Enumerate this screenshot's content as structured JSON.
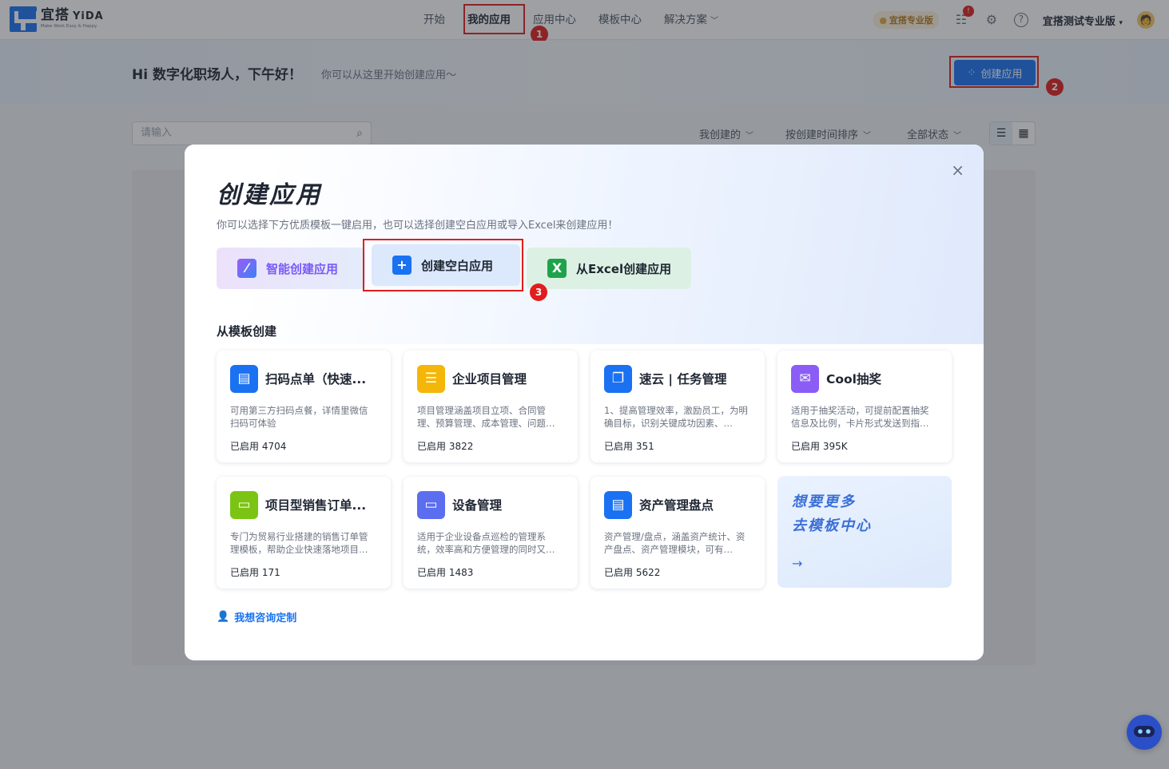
{
  "brand": {
    "name": "宜搭",
    "name_en": "YiDA",
    "slogan": "Make Work Easy & Happy",
    "color": "#1a72f2"
  },
  "nav": {
    "items": [
      {
        "label": "开始"
      },
      {
        "label": "我的应用",
        "active": true
      },
      {
        "label": "应用中心"
      },
      {
        "label": "模板中心"
      },
      {
        "label": "解决方案"
      }
    ]
  },
  "top_right": {
    "pro_tag": "宜搭专业版",
    "notice_count": "!",
    "account": "宜搭测试专业版",
    "avatar": "🧑"
  },
  "greeting": {
    "title": "Hi 数字化职场人，下午好！",
    "subtitle": "你可以从这里开始创建应用～",
    "create_button": "创建应用"
  },
  "filters": {
    "search_placeholder": "请输入",
    "created_by": "我创建的",
    "sort": "按创建时间排序",
    "status": "全部状态"
  },
  "annotations": [
    "1",
    "2",
    "3"
  ],
  "modal": {
    "title": "创建应用",
    "subtitle": "你可以选择下方优质模板一键启用，也可以选择创建空白应用或导入Excel来创建应用！",
    "options": {
      "ai": "智能创建应用",
      "blank": "创建空白应用",
      "excel": "从Excel创建应用"
    },
    "template_section": "从模板创建",
    "templates": [
      {
        "title": "扫码点单（快速...",
        "desc": "可用第三方扫码点餐，详情里微信扫码可体验",
        "count": "已启用 4704",
        "color": "#1a72f2",
        "icon": "▤"
      },
      {
        "title": "企业项目管理",
        "desc": "项目管理涵盖项目立项、合同管理、预算管理、成本管理、问题…",
        "count": "已启用 3822",
        "color": "#f5b60a",
        "icon": "☰"
      },
      {
        "title": "速云 | 任务管理",
        "desc": "1、提高管理效率，激励员工，为明确目标，识别关键成功因素、…",
        "count": "已启用 351",
        "color": "#1a72f2",
        "icon": "❐"
      },
      {
        "title": "Cool抽奖",
        "desc": "适用于抽奖活动，可提前配置抽奖信息及比例，卡片形式发送到指…",
        "count": "已启用 395K",
        "color": "#8b5cf6",
        "icon": "✉"
      },
      {
        "title": "项目型销售订单...",
        "desc": "专门为贸易行业搭建的销售订单管理模板，帮助企业快速落地项目…",
        "count": "已启用 171",
        "color": "#7cc414",
        "icon": "▭"
      },
      {
        "title": "设备管理",
        "desc": "适用于企业设备点巡检的管理系统，效率高和方便管理的同时又…",
        "count": "已启用 1483",
        "color": "#5b6ef0",
        "icon": "▭"
      },
      {
        "title": "资产管理盘点",
        "desc": "资产管理/盘点，涵盖资产统计、资产盘点、资产管理模块，可有…",
        "count": "已启用 5622",
        "color": "#1a72f2",
        "icon": "▤"
      }
    ],
    "more": {
      "line1": "想要更多",
      "line2": "去模板中心",
      "arrow": "→"
    },
    "consult": "我想咨询定制",
    "close": "×"
  }
}
